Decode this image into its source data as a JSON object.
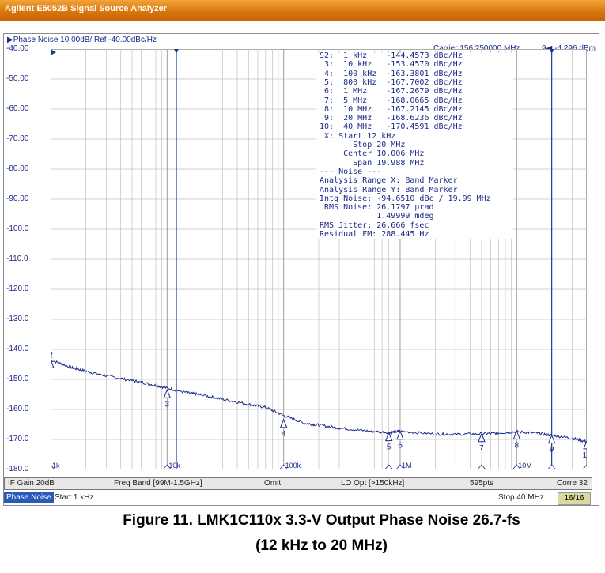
{
  "window": {
    "title": "Agilent E5052B Signal Source Analyzer"
  },
  "header": {
    "trace_label": "Phase Noise 10.00dB/ Ref -40.00dBc/Hz",
    "carrier": "Carrier 156.250000 MHz",
    "marker_index": "9",
    "marker_value": "-4.296 dBm"
  },
  "y_axis": {
    "ticks": [
      "-40.00",
      "-50.00",
      "-60.00",
      "-70.00",
      "-80.00",
      "-90.00",
      "-100.0",
      "-110.0",
      "-120.0",
      "-130.0",
      "-140.0",
      "-150.0",
      "-160.0",
      "-170.0",
      "-180.0"
    ]
  },
  "x_axis": {
    "ticks": [
      "1k",
      "10k",
      "100k",
      "1M",
      "10M"
    ]
  },
  "markers": [
    {
      "id": "2",
      "freq_hz": 1000,
      "dbc": -143.5
    },
    {
      "id": "3",
      "freq_hz": 10000,
      "dbc": -153.5
    },
    {
      "id": "4",
      "freq_hz": 100000,
      "dbc": -163.4
    },
    {
      "id": "5",
      "freq_hz": 800000,
      "dbc": -167.8
    },
    {
      "id": "6",
      "freq_hz": 1000000,
      "dbc": -167.3
    },
    {
      "id": "7",
      "freq_hz": 5000000,
      "dbc": -168.1
    },
    {
      "id": "8",
      "freq_hz": 10000000,
      "dbc": -167.2
    },
    {
      "id": "9",
      "freq_hz": 20000000,
      "dbc": -168.6
    },
    {
      "id": "10",
      "freq_hz": 40000000,
      "dbc": -170.5
    }
  ],
  "marker_table": [
    "S2:  1 kHz    -144.4573 dBc/Hz",
    " 3:  10 kHz   -153.4570 dBc/Hz",
    " 4:  100 kHz  -163.3801 dBc/Hz",
    " 5:  800 kHz  -167.7002 dBc/Hz",
    " 6:  1 MHz    -167.2679 dBc/Hz",
    " 7:  5 MHz    -168.0665 dBc/Hz",
    " 8:  10 MHz   -167.2145 dBc/Hz",
    " 9:  20 MHz   -168.6236 dBc/Hz",
    "10:  40 MHz   -170.4591 dBc/Hz",
    " X: Start 12 kHz",
    "       Stop 20 MHz",
    "     Center 10.006 MHz",
    "       Span 19.988 MHz",
    "--- Noise ---",
    "Analysis Range X: Band Marker",
    "Analysis Range Y: Band Marker",
    "Intg Noise: -94.6510 dBc / 19.99 MHz",
    " RMS Noise: 26.1797 µrad",
    "            1.49999 mdeg",
    "RMS Jitter: 26.666 fsec",
    "Residual FM: 288.445 Hz"
  ],
  "status_bar": {
    "if_gain": "IF Gain 20dB",
    "freq_band": "Freq Band [99M-1.5GHz]",
    "omit": "Omit",
    "lo_opt": "LO Opt [>150kHz]",
    "points": "595pts",
    "corre": "Corre 32"
  },
  "bottom_bar": {
    "mode": "Phase Noise",
    "start": "Start 1 kHz",
    "stop": "Stop 40 MHz",
    "page": "16/16"
  },
  "caption": {
    "line1": "Figure 11. LMK1C110x 3.3-V Output Phase Noise 26.7-fs",
    "line2": "(12 kHz to 20 MHz)"
  },
  "chart_data": {
    "type": "line",
    "x_scale": "log",
    "xlim_hz": [
      1000,
      40000000
    ],
    "ylim": [
      -180,
      -40
    ],
    "series": [
      {
        "x": [
          1000,
          1500,
          2000,
          3000,
          5000,
          7000,
          10000,
          15000,
          20000,
          30000,
          50000,
          70000,
          100000,
          150000,
          200000,
          300000,
          500000,
          800000,
          1000000,
          2000000,
          3000000,
          5000000,
          7000000,
          10000000,
          15000000,
          20000000,
          30000000,
          40000000
        ],
        "y": [
          -143.5,
          -146,
          -147.3,
          -148.8,
          -150.4,
          -151.5,
          -152.9,
          -154.5,
          -155.2,
          -156.6,
          -158.3,
          -159.3,
          -162,
          -164.6,
          -165.2,
          -166.2,
          -167.1,
          -167.7,
          -167.3,
          -168.2,
          -168.3,
          -168.1,
          -167.9,
          -167.4,
          -167.9,
          -168.6,
          -169.6,
          -170.8
        ]
      }
    ],
    "colors": {
      "trace": "#1a2a8a",
      "grid": "#c0c0c0",
      "text": "#1a2a8a"
    }
  }
}
